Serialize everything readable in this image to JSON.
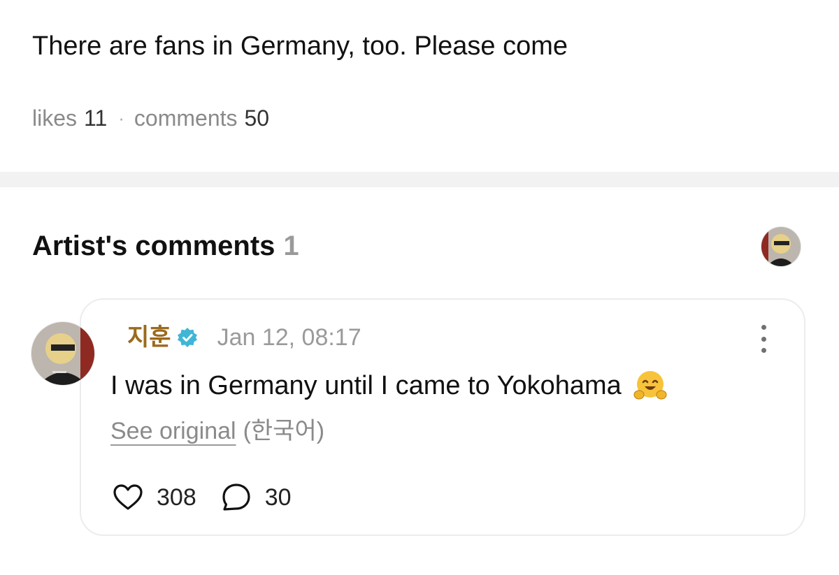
{
  "post": {
    "text": "There are fans in Germany, too. Please come",
    "likes_label": "likes",
    "likes_count": "11",
    "separator": "·",
    "comments_label": "comments",
    "comments_count": "50"
  },
  "artist_comments": {
    "title": "Artist's comments",
    "count": "1",
    "comment": {
      "author": "지훈",
      "verified": true,
      "timestamp": "Jan 12, 08:17",
      "text": "I was in Germany until I came to Yokohama",
      "emoji": "hugging-face-emoji",
      "see_original_label": "See original",
      "original_language": "(한국어)",
      "like_count": "308",
      "reply_count": "30"
    }
  },
  "colors": {
    "author_name": "#9b6a1c",
    "verified_badge": "#3fb6d6",
    "muted_text": "#8a8a8a",
    "divider": "#f2f2f2",
    "card_border": "#ececec"
  },
  "icons": {
    "verified": "verified-badge-icon",
    "more": "more-vertical-icon",
    "like": "heart-icon",
    "reply": "comment-bubble-icon"
  }
}
